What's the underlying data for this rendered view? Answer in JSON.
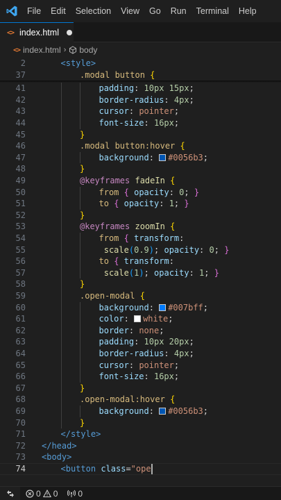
{
  "menu": [
    "File",
    "Edit",
    "Selection",
    "View",
    "Go",
    "Run",
    "Terminal",
    "Help"
  ],
  "tab": {
    "label": "index.html",
    "icon": "html-file-icon",
    "modified": true
  },
  "breadcrumb": {
    "file": "index.html",
    "separator": "›",
    "symbol": "body"
  },
  "editor": {
    "active_line": "74",
    "sticky": [
      {
        "ln": "2",
        "indent": 1,
        "tokens": [
          [
            "t-tag",
            "<style>"
          ]
        ]
      },
      {
        "ln": "37",
        "indent": 2,
        "tokens": [
          [
            "t-sel",
            ".modal button"
          ],
          [
            "t-def",
            " "
          ],
          [
            "t-br1",
            "{"
          ]
        ]
      }
    ],
    "lines": [
      {
        "ln": "41",
        "indent": 3,
        "tokens": [
          [
            "t-prop",
            "padding"
          ],
          [
            "t-def",
            ": "
          ],
          [
            "t-num",
            "10px 15px"
          ],
          [
            "t-def",
            ";"
          ]
        ]
      },
      {
        "ln": "42",
        "indent": 3,
        "tokens": [
          [
            "t-prop",
            "border-radius"
          ],
          [
            "t-def",
            ": "
          ],
          [
            "t-num",
            "4px"
          ],
          [
            "t-def",
            ";"
          ]
        ]
      },
      {
        "ln": "43",
        "indent": 3,
        "tokens": [
          [
            "t-prop",
            "cursor"
          ],
          [
            "t-def",
            ": "
          ],
          [
            "t-val",
            "pointer"
          ],
          [
            "t-def",
            ";"
          ]
        ]
      },
      {
        "ln": "44",
        "indent": 3,
        "tokens": [
          [
            "t-prop",
            "font-size"
          ],
          [
            "t-def",
            ": "
          ],
          [
            "t-num",
            "16px"
          ],
          [
            "t-def",
            ";"
          ]
        ]
      },
      {
        "ln": "45",
        "indent": 2,
        "tokens": [
          [
            "t-br1",
            "}"
          ]
        ]
      },
      {
        "ln": "46",
        "indent": 2,
        "tokens": [
          [
            "t-sel",
            ".modal button:hover"
          ],
          [
            "t-def",
            " "
          ],
          [
            "t-br1",
            "{"
          ]
        ]
      },
      {
        "ln": "47",
        "indent": 3,
        "tokens": [
          [
            "t-prop",
            "background"
          ],
          [
            "t-def",
            ": "
          ],
          [
            "swatch",
            "#0056b3"
          ],
          [
            "t-val",
            "#0056b3"
          ],
          [
            "t-def",
            ";"
          ]
        ]
      },
      {
        "ln": "48",
        "indent": 2,
        "tokens": [
          [
            "t-br1",
            "}"
          ]
        ]
      },
      {
        "ln": "49",
        "indent": 2,
        "tokens": [
          [
            "t-at",
            "@keyframes"
          ],
          [
            "t-def",
            " "
          ],
          [
            "t-fn",
            "fadeIn"
          ],
          [
            "t-def",
            " "
          ],
          [
            "t-br1",
            "{"
          ]
        ]
      },
      {
        "ln": "50",
        "indent": 3,
        "tokens": [
          [
            "t-kw",
            "from"
          ],
          [
            "t-def",
            " "
          ],
          [
            "t-br2",
            "{"
          ],
          [
            "t-def",
            " "
          ],
          [
            "t-prop",
            "opacity"
          ],
          [
            "t-def",
            ": "
          ],
          [
            "t-num",
            "0"
          ],
          [
            "t-def",
            "; "
          ],
          [
            "t-br2",
            "}"
          ]
        ]
      },
      {
        "ln": "51",
        "indent": 3,
        "tokens": [
          [
            "t-kw",
            "to"
          ],
          [
            "t-def",
            " "
          ],
          [
            "t-br2",
            "{"
          ],
          [
            "t-def",
            " "
          ],
          [
            "t-prop",
            "opacity"
          ],
          [
            "t-def",
            ": "
          ],
          [
            "t-num",
            "1"
          ],
          [
            "t-def",
            "; "
          ],
          [
            "t-br2",
            "}"
          ]
        ]
      },
      {
        "ln": "52",
        "indent": 2,
        "tokens": [
          [
            "t-br1",
            "}"
          ]
        ]
      },
      {
        "ln": "53",
        "indent": 2,
        "tokens": [
          [
            "t-at",
            "@keyframes"
          ],
          [
            "t-def",
            " "
          ],
          [
            "t-fn",
            "zoomIn"
          ],
          [
            "t-def",
            " "
          ],
          [
            "t-br1",
            "{"
          ]
        ]
      },
      {
        "ln": "54",
        "indent": 3,
        "tokens": [
          [
            "t-kw",
            "from"
          ],
          [
            "t-def",
            " "
          ],
          [
            "t-br2",
            "{"
          ],
          [
            "t-def",
            " "
          ],
          [
            "t-prop",
            "transform"
          ],
          [
            "t-def",
            ":"
          ]
        ]
      },
      {
        "ln": "55",
        "indent": 3,
        "tokens": [
          [
            "t-def",
            " "
          ],
          [
            "t-fn",
            "scale"
          ],
          [
            "t-br3",
            "("
          ],
          [
            "t-num",
            "0.9"
          ],
          [
            "t-br3",
            ")"
          ],
          [
            "t-def",
            "; "
          ],
          [
            "t-prop",
            "opacity"
          ],
          [
            "t-def",
            ": "
          ],
          [
            "t-num",
            "0"
          ],
          [
            "t-def",
            "; "
          ],
          [
            "t-br2",
            "}"
          ]
        ]
      },
      {
        "ln": "56",
        "indent": 3,
        "tokens": [
          [
            "t-kw",
            "to"
          ],
          [
            "t-def",
            " "
          ],
          [
            "t-br2",
            "{"
          ],
          [
            "t-def",
            " "
          ],
          [
            "t-prop",
            "transform"
          ],
          [
            "t-def",
            ":"
          ]
        ]
      },
      {
        "ln": "57",
        "indent": 3,
        "tokens": [
          [
            "t-def",
            " "
          ],
          [
            "t-fn",
            "scale"
          ],
          [
            "t-br3",
            "("
          ],
          [
            "t-num",
            "1"
          ],
          [
            "t-br3",
            ")"
          ],
          [
            "t-def",
            "; "
          ],
          [
            "t-prop",
            "opacity"
          ],
          [
            "t-def",
            ": "
          ],
          [
            "t-num",
            "1"
          ],
          [
            "t-def",
            "; "
          ],
          [
            "t-br2",
            "}"
          ]
        ]
      },
      {
        "ln": "58",
        "indent": 2,
        "tokens": [
          [
            "t-br1",
            "}"
          ]
        ]
      },
      {
        "ln": "59",
        "indent": 2,
        "tokens": [
          [
            "t-sel",
            ".open-modal"
          ],
          [
            "t-def",
            " "
          ],
          [
            "t-br1",
            "{"
          ]
        ]
      },
      {
        "ln": "60",
        "indent": 3,
        "tokens": [
          [
            "t-prop",
            "background"
          ],
          [
            "t-def",
            ": "
          ],
          [
            "swatch",
            "#007bff"
          ],
          [
            "t-val",
            "#007bff"
          ],
          [
            "t-def",
            ";"
          ]
        ]
      },
      {
        "ln": "61",
        "indent": 3,
        "tokens": [
          [
            "t-prop",
            "color"
          ],
          [
            "t-def",
            ": "
          ],
          [
            "swatch",
            "#ffffff"
          ],
          [
            "t-val",
            "white"
          ],
          [
            "t-def",
            ";"
          ]
        ]
      },
      {
        "ln": "62",
        "indent": 3,
        "tokens": [
          [
            "t-prop",
            "border"
          ],
          [
            "t-def",
            ": "
          ],
          [
            "t-val",
            "none"
          ],
          [
            "t-def",
            ";"
          ]
        ]
      },
      {
        "ln": "63",
        "indent": 3,
        "tokens": [
          [
            "t-prop",
            "padding"
          ],
          [
            "t-def",
            ": "
          ],
          [
            "t-num",
            "10px 20px"
          ],
          [
            "t-def",
            ";"
          ]
        ]
      },
      {
        "ln": "64",
        "indent": 3,
        "tokens": [
          [
            "t-prop",
            "border-radius"
          ],
          [
            "t-def",
            ": "
          ],
          [
            "t-num",
            "4px"
          ],
          [
            "t-def",
            ";"
          ]
        ]
      },
      {
        "ln": "65",
        "indent": 3,
        "tokens": [
          [
            "t-prop",
            "cursor"
          ],
          [
            "t-def",
            ": "
          ],
          [
            "t-val",
            "pointer"
          ],
          [
            "t-def",
            ";"
          ]
        ]
      },
      {
        "ln": "66",
        "indent": 3,
        "tokens": [
          [
            "t-prop",
            "font-size"
          ],
          [
            "t-def",
            ": "
          ],
          [
            "t-num",
            "16px"
          ],
          [
            "t-def",
            ";"
          ]
        ]
      },
      {
        "ln": "67",
        "indent": 2,
        "tokens": [
          [
            "t-br1",
            "}"
          ]
        ]
      },
      {
        "ln": "68",
        "indent": 2,
        "tokens": [
          [
            "t-sel",
            ".open-modal:hover"
          ],
          [
            "t-def",
            " "
          ],
          [
            "t-br1",
            "{"
          ]
        ]
      },
      {
        "ln": "69",
        "indent": 3,
        "tokens": [
          [
            "t-prop",
            "background"
          ],
          [
            "t-def",
            ": "
          ],
          [
            "swatch",
            "#0056b3"
          ],
          [
            "t-val",
            "#0056b3"
          ],
          [
            "t-def",
            ";"
          ]
        ]
      },
      {
        "ln": "70",
        "indent": 2,
        "tokens": [
          [
            "t-br1",
            "}"
          ]
        ]
      },
      {
        "ln": "71",
        "indent": 1,
        "tokens": [
          [
            "t-tag",
            "</style>"
          ]
        ]
      },
      {
        "ln": "72",
        "indent": 0,
        "tokens": [
          [
            "t-tag",
            "</head>"
          ]
        ]
      },
      {
        "ln": "73",
        "indent": 0,
        "tokens": [
          [
            "t-tag",
            "<body>"
          ]
        ]
      },
      {
        "ln": "74",
        "indent": 1,
        "tokens": [
          [
            "t-tag",
            "<button"
          ],
          [
            "t-def",
            " "
          ],
          [
            "t-attr",
            "class"
          ],
          [
            "t-def",
            "="
          ],
          [
            "t-str",
            "\"ope"
          ]
        ]
      }
    ]
  },
  "status": {
    "errors": "0",
    "warnings": "0",
    "ports": "0"
  },
  "colors": {
    "accent": "#0078d4",
    "editor_bg": "#1f1f1f",
    "statusbar_bg": "#181818"
  }
}
